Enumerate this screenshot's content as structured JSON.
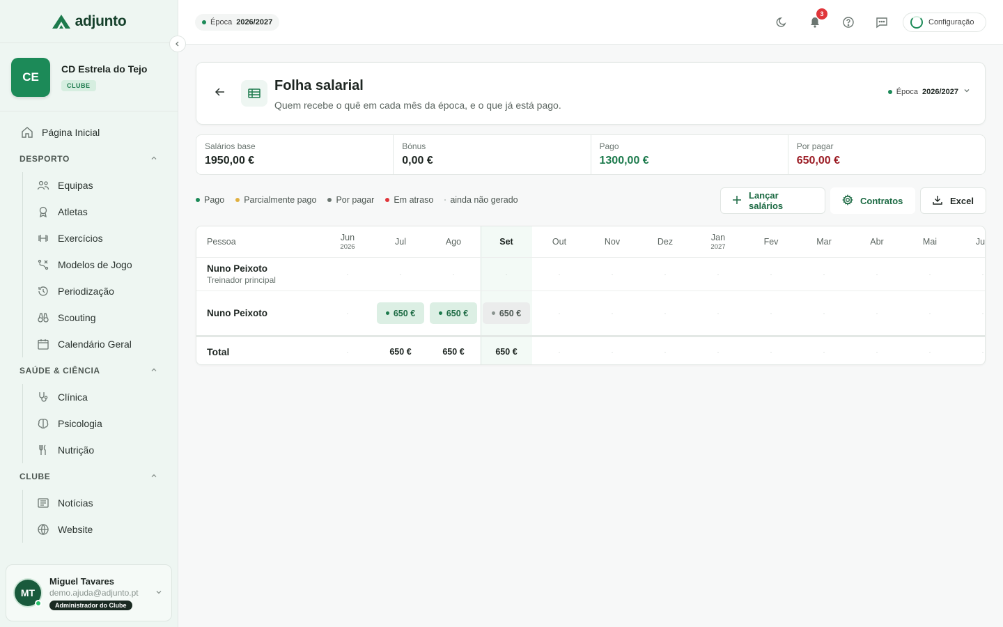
{
  "brand": {
    "name": "adjunto"
  },
  "club": {
    "initials": "CE",
    "name": "CD Estrela do Tejo",
    "badge": "CLUBE"
  },
  "nav": {
    "home": "Página Inicial",
    "sections": [
      {
        "title": "DESPORTO",
        "items": [
          {
            "label": "Equipas",
            "icon": "team-icon"
          },
          {
            "label": "Atletas",
            "icon": "athlete-icon"
          },
          {
            "label": "Exercícios",
            "icon": "dumbbell-icon"
          },
          {
            "label": "Modelos de Jogo",
            "icon": "tactics-icon"
          },
          {
            "label": "Periodização",
            "icon": "history-icon"
          },
          {
            "label": "Scouting",
            "icon": "binoculars-icon"
          },
          {
            "label": "Calendário Geral",
            "icon": "calendar-icon"
          }
        ]
      },
      {
        "title": "SAÚDE & CIÊNCIA",
        "items": [
          {
            "label": "Clínica",
            "icon": "stethoscope-icon"
          },
          {
            "label": "Psicologia",
            "icon": "brain-icon"
          },
          {
            "label": "Nutrição",
            "icon": "utensils-icon"
          }
        ]
      },
      {
        "title": "CLUBE",
        "items": [
          {
            "label": "Notícias",
            "icon": "newspaper-icon"
          },
          {
            "label": "Website",
            "icon": "globe-icon"
          }
        ]
      }
    ]
  },
  "user": {
    "initials": "MT",
    "name": "Miguel Tavares",
    "email": "demo.ajuda@adjunto.pt",
    "role": "Administrador do Clube"
  },
  "topbar": {
    "season_label": "Época",
    "season_value": "2026/2027",
    "notifications": "3",
    "config_label": "Configuração"
  },
  "page": {
    "title": "Folha salarial",
    "subtitle": "Quem recebe o quê em cada mês da época, e o que já está pago.",
    "season_label": "Época",
    "season_value": "2026/2027"
  },
  "stats": [
    {
      "label": "Salários base",
      "value": "1950,00 €",
      "tone": "default"
    },
    {
      "label": "Bónus",
      "value": "0,00 €",
      "tone": "default"
    },
    {
      "label": "Pago",
      "value": "1300,00 €",
      "tone": "green"
    },
    {
      "label": "Por pagar",
      "value": "650,00 €",
      "tone": "red"
    }
  ],
  "legend": [
    {
      "label": "Pago",
      "color": "#1c8a58"
    },
    {
      "label": "Parcialmente pago",
      "color": "#e0b040"
    },
    {
      "label": "Por pagar",
      "color": "#6b7671"
    },
    {
      "label": "Em atraso",
      "color": "#e0353a"
    },
    {
      "label": "ainda não gerado",
      "color": "#b8c0bc"
    }
  ],
  "actions": {
    "launch": "Lançar salários",
    "contracts": "Contratos",
    "excel": "Excel"
  },
  "table": {
    "person_header": "Pessoa",
    "empty_mark": "·",
    "months": [
      {
        "label": "Jun",
        "year": "2026"
      },
      {
        "label": "Jul",
        "year": ""
      },
      {
        "label": "Ago",
        "year": ""
      },
      {
        "label": "Set",
        "year": "",
        "current": true
      },
      {
        "label": "Out",
        "year": ""
      },
      {
        "label": "Nov",
        "year": ""
      },
      {
        "label": "Dez",
        "year": ""
      },
      {
        "label": "Jan",
        "year": "2027"
      },
      {
        "label": "Fev",
        "year": ""
      },
      {
        "label": "Mar",
        "year": ""
      },
      {
        "label": "Abr",
        "year": ""
      },
      {
        "label": "Mai",
        "year": ""
      },
      {
        "label": "Jun",
        "year": ""
      }
    ],
    "rows": [
      {
        "name": "Nuno Peixoto",
        "role": "Treinador principal",
        "cells": [
          "",
          "",
          "",
          "",
          "",
          "",
          "",
          "",
          "",
          "",
          "",
          "",
          ""
        ]
      },
      {
        "name": "Nuno Peixoto",
        "role": "",
        "cells": [
          "",
          "650 €|paid",
          "650 €|paid",
          "650 €|pending",
          "",
          "",
          "",
          "",
          "",
          "",
          "",
          "",
          ""
        ]
      }
    ],
    "total_label": "Total",
    "totals": [
      "",
      "650 €",
      "650 €",
      "650 €",
      "",
      "",
      "",
      "",
      "",
      "",
      "",
      "",
      ""
    ]
  }
}
